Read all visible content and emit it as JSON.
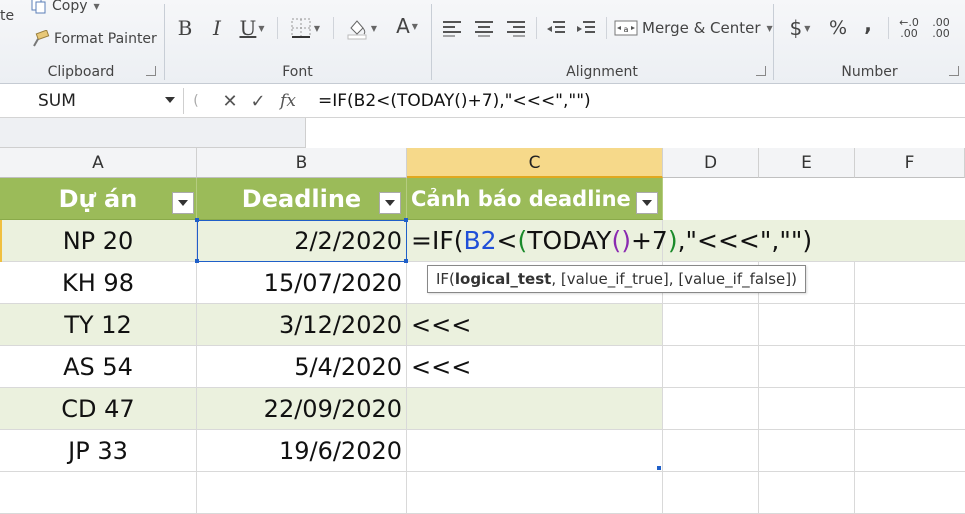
{
  "ribbon": {
    "clipboard": {
      "paste_fragment": "te",
      "copy_label": "Copy",
      "format_painter_label": "Format Painter",
      "group_label": "Clipboard"
    },
    "font": {
      "bold": "B",
      "italic": "I",
      "underline": "U",
      "font_color": "A",
      "group_label": "Font"
    },
    "alignment": {
      "merge_label": "Merge & Center",
      "group_label": "Alignment"
    },
    "number": {
      "currency": "$",
      "percent": "%",
      "comma": ",",
      "inc_decimal": ".00",
      "dec_decimal": ".00",
      "group_label": "Number"
    }
  },
  "formula_bar": {
    "name_box": "SUM",
    "cancel_glyph": "✕",
    "enter_glyph": "✓",
    "fx_glyph": "fx",
    "formula": "=IF(B2<(TODAY()+7),\"<<<\",\"\")"
  },
  "grid": {
    "columns": [
      "A",
      "B",
      "C",
      "D",
      "E",
      "F"
    ],
    "headers": {
      "a": "Dự án",
      "b": "Deadline",
      "c": "Cảnh báo deadline"
    },
    "rows": [
      {
        "project": "NP 20",
        "deadline": "2/2/2020",
        "warning": ""
      },
      {
        "project": "KH 98",
        "deadline": "15/07/2020",
        "warning": ""
      },
      {
        "project": "TY 12",
        "deadline": "3/12/2020",
        "warning": "<<<"
      },
      {
        "project": "AS 54",
        "deadline": "5/4/2020",
        "warning": "<<<"
      },
      {
        "project": "CD 47",
        "deadline": "22/09/2020",
        "warning": ""
      },
      {
        "project": "JP 33",
        "deadline": "19/6/2020",
        "warning": ""
      }
    ],
    "editing": {
      "p1": "=IF(",
      "ref": "B2",
      "p2": "<",
      "open": "(",
      "fn": "TODAY",
      "parens": "()",
      "p3": "+7",
      "close": ")",
      "p4": ",\"<<<\",\"\")"
    },
    "tooltip": {
      "prefix": "IF(",
      "arg1": "logical_test",
      "rest": ", [value_if_true], [value_if_false])"
    }
  },
  "colors": {
    "header_green": "#9bbb59",
    "band": "#ebf1de",
    "selection": "#1f5fc8"
  }
}
